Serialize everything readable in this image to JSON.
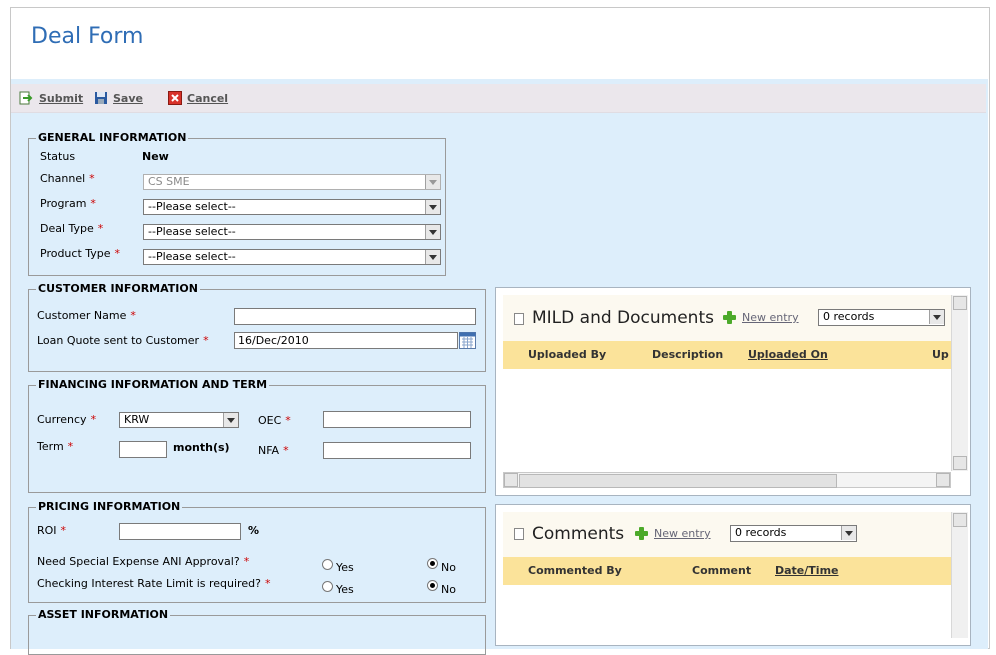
{
  "page": {
    "title": "Deal Form"
  },
  "toolbar": {
    "submit": "Submit",
    "save": "Save",
    "cancel": "Cancel"
  },
  "required_mark": "*",
  "general": {
    "legend": "GENERAL INFORMATION",
    "status_label": "Status",
    "status_value": "New",
    "channel_label": "Channel",
    "channel_value": "CS SME",
    "program_label": "Program",
    "program_value": "--Please select--",
    "deal_type_label": "Deal Type",
    "deal_type_value": "--Please select--",
    "product_type_label": "Product Type",
    "product_type_value": "--Please select--"
  },
  "customer": {
    "legend": "CUSTOMER INFORMATION",
    "name_label": "Customer Name",
    "name_value": "",
    "quote_label": "Loan Quote sent to Customer",
    "quote_value": "16/Dec/2010"
  },
  "financing": {
    "legend": "FINANCING INFORMATION AND TERM",
    "currency_label": "Currency",
    "currency_value": "KRW",
    "oec_label": "OEC",
    "term_label": "Term",
    "term_unit": "month(s)",
    "nfa_label": "NFA"
  },
  "pricing": {
    "legend": "PRICING INFORMATION",
    "roi_label": "ROI",
    "roi_unit": "%",
    "q1_label": "Need Special Expense ANI Approval?",
    "q2_label": "Checking Interest Rate Limit is required?",
    "yes": "Yes",
    "no": "No"
  },
  "asset": {
    "legend": "ASSET INFORMATION"
  },
  "documents_panel": {
    "title": "MILD and Documents",
    "new_entry": "New entry",
    "records": "0 records",
    "columns": [
      "Uploaded By",
      "Description",
      "Uploaded On",
      "Up"
    ]
  },
  "comments_panel": {
    "title": "Comments",
    "new_entry": "New entry",
    "records": "0 records",
    "columns": [
      "Commented By",
      "Comment",
      "Date/Time"
    ]
  },
  "colors": {
    "title": "#2f6db5",
    "background": "#ddeefb",
    "grid_header": "#fbe39a",
    "required": "#cc0000"
  }
}
